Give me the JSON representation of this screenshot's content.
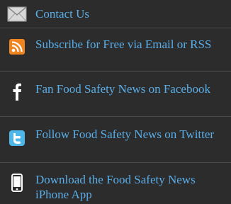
{
  "links": [
    {
      "label": "Contact Us",
      "icon": "envelope-icon"
    },
    {
      "label": "Subscribe for Free via Email or RSS",
      "icon": "rss-icon"
    },
    {
      "label": "Fan Food Safety News on Facebook",
      "icon": "facebook-icon"
    },
    {
      "label": "Follow Food Safety News on Twitter",
      "icon": "twitter-icon"
    },
    {
      "label": "Download the Food Safety News iPhone App",
      "icon": "iphone-icon"
    }
  ],
  "colors": {
    "background": "#2c2c2c",
    "link": "#5aaee8",
    "rss": "#f0851f",
    "twitter": "#4cb7e8"
  }
}
